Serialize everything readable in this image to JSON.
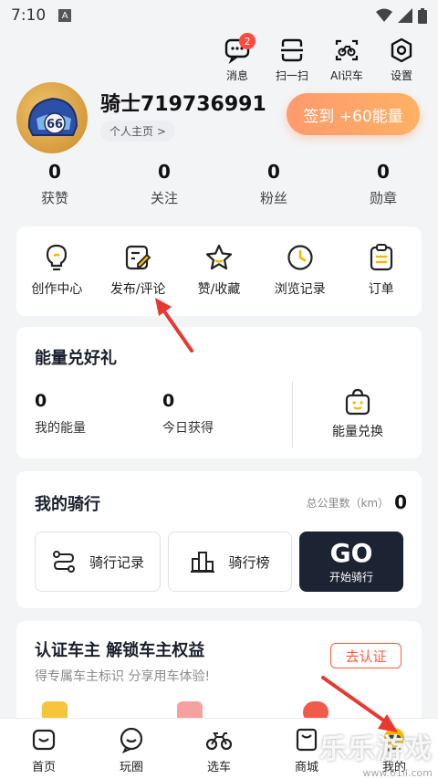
{
  "status_bar": {
    "time": "7:10",
    "notif_icon": "A"
  },
  "top_actions": [
    {
      "label": "消息",
      "icon": "message-icon",
      "badge": "2"
    },
    {
      "label": "扫一扫",
      "icon": "scan-icon"
    },
    {
      "label": "AI识车",
      "icon": "ai-bike-icon"
    },
    {
      "label": "设置",
      "icon": "settings-icon"
    }
  ],
  "profile": {
    "username": "骑士719736991",
    "profile_link": "个人主页 >",
    "avatar_text": "66",
    "checkin_label": "签到 +60能量"
  },
  "stats": [
    {
      "value": "0",
      "label": "获赞"
    },
    {
      "value": "0",
      "label": "关注"
    },
    {
      "value": "0",
      "label": "粉丝"
    },
    {
      "value": "0",
      "label": "勋章"
    }
  ],
  "shortcuts": [
    {
      "label": "创作中心",
      "icon": "bulb-icon"
    },
    {
      "label": "发布/评论",
      "icon": "edit-icon"
    },
    {
      "label": "赞/收藏",
      "icon": "star-icon"
    },
    {
      "label": "浏览记录",
      "icon": "clock-icon"
    },
    {
      "label": "订单",
      "icon": "order-icon"
    }
  ],
  "energy": {
    "title": "能量兑好礼",
    "my_energy_value": "0",
    "my_energy_label": "我的能量",
    "today_value": "0",
    "today_label": "今日获得",
    "exchange_label": "能量兑换"
  },
  "riding": {
    "title": "我的骑行",
    "total_label": "总公里数（km）",
    "total_value": "0",
    "record_label": "骑行记录",
    "rank_label": "骑行榜",
    "go_label": "GO",
    "go_sub": "开始骑行"
  },
  "verify": {
    "title": "认证车主 解锁车主权益",
    "subtitle": "得专属车主标识 分享用车体验!",
    "button": "去认证"
  },
  "bottom_nav": [
    {
      "label": "首页",
      "icon": "home-icon"
    },
    {
      "label": "玩圈",
      "icon": "chat-circle-icon"
    },
    {
      "label": "选车",
      "icon": "motorcycle-icon"
    },
    {
      "label": "商城",
      "icon": "shop-bag-icon"
    },
    {
      "label": "我的",
      "icon": "my-avatar-icon"
    }
  ],
  "watermark": {
    "text": "乐乐游戏",
    "url": "www.61ll.com"
  },
  "colors": {
    "accent": "#ff9a6e",
    "dark_button": "#1c2333",
    "verify": "#ff5a3c",
    "annotation_arrow": "#e8382f"
  }
}
